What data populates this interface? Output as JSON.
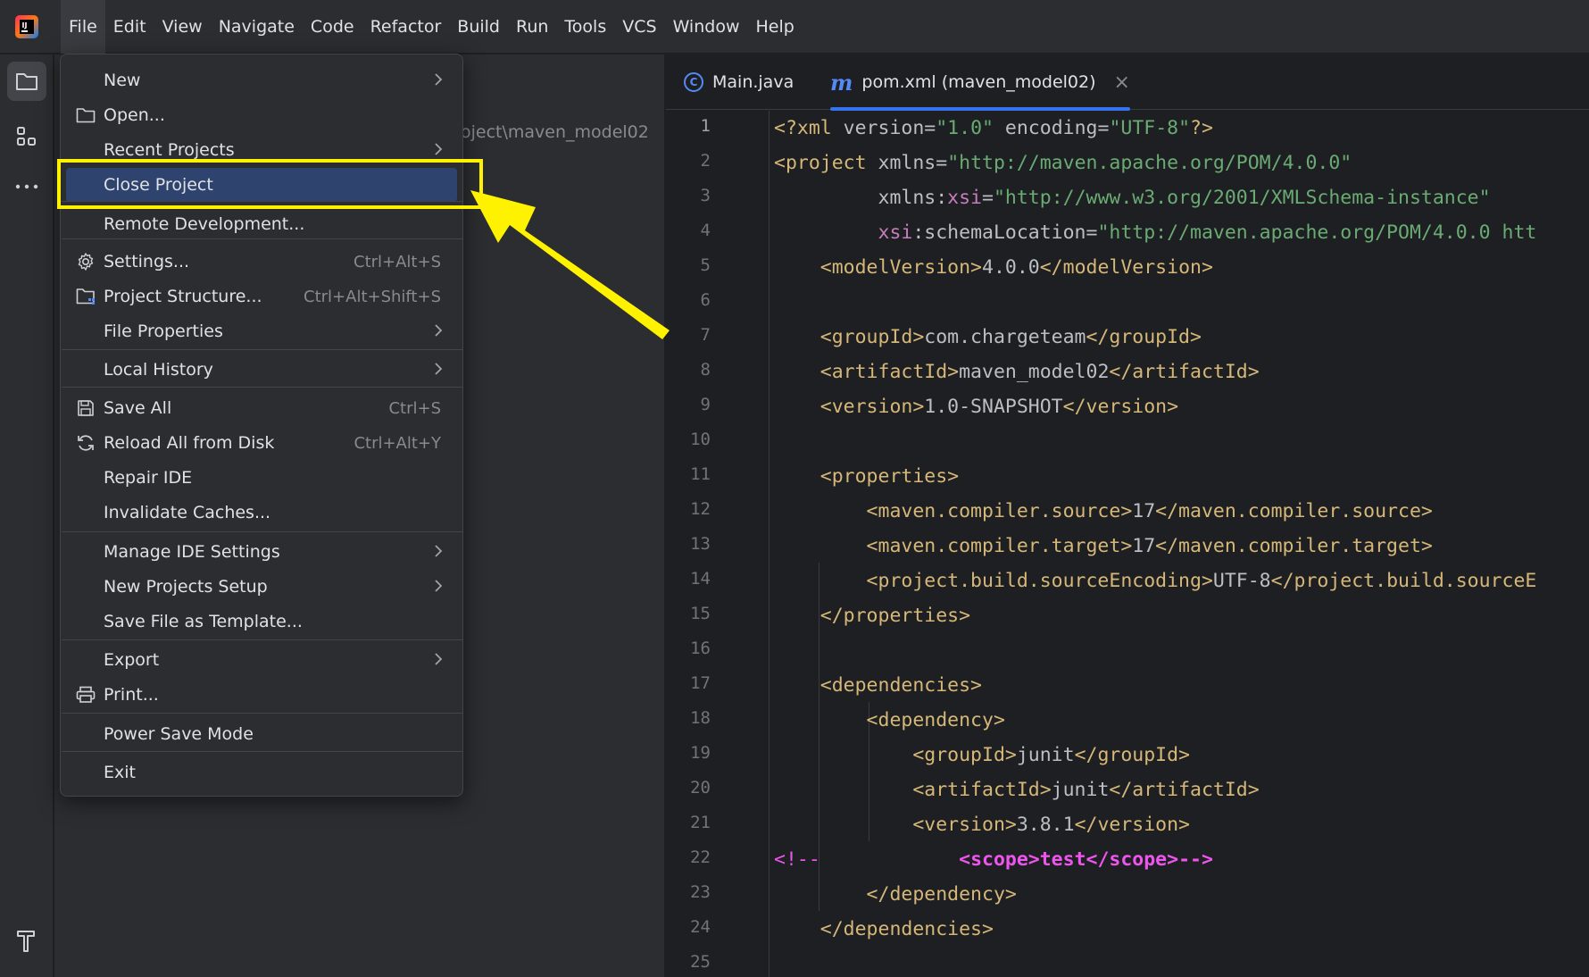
{
  "menubar": {
    "logo_icon": "intellij-idea-logo",
    "items": [
      {
        "label": "File",
        "active": true
      },
      {
        "label": "Edit"
      },
      {
        "label": "View"
      },
      {
        "label": "Navigate"
      },
      {
        "label": "Code"
      },
      {
        "label": "Refactor"
      },
      {
        "label": "Build"
      },
      {
        "label": "Run"
      },
      {
        "label": "Tools"
      },
      {
        "label": "VCS"
      },
      {
        "label": "Window"
      },
      {
        "label": "Help"
      }
    ]
  },
  "toolstrip": {
    "icons": [
      "folder-icon",
      "structure-icon",
      "more-icon",
      "build-hammer-icon"
    ]
  },
  "project_panel": {
    "path_fragment": "oject\\maven_model02"
  },
  "file_menu": {
    "items": [
      {
        "label": "New",
        "submenu": true
      },
      {
        "label": "Open...",
        "icon": "folder-icon"
      },
      {
        "label": "Recent Projects",
        "submenu": true
      },
      {
        "label": "Close Project",
        "highlighted": true
      },
      {
        "label": "Remote Development..."
      },
      {
        "label": "Settings...",
        "icon": "gear-icon",
        "shortcut": "Ctrl+Alt+S"
      },
      {
        "label": "Project Structure...",
        "icon": "project-structure-icon",
        "shortcut": "Ctrl+Alt+Shift+S"
      },
      {
        "label": "File Properties",
        "submenu": true
      },
      {
        "label": "Local History",
        "submenu": true
      },
      {
        "label": "Save All",
        "icon": "save-icon",
        "shortcut": "Ctrl+S"
      },
      {
        "label": "Reload All from Disk",
        "icon": "reload-icon",
        "shortcut": "Ctrl+Alt+Y"
      },
      {
        "label": "Repair IDE"
      },
      {
        "label": "Invalidate Caches..."
      },
      {
        "label": "Manage IDE Settings",
        "submenu": true
      },
      {
        "label": "New Projects Setup",
        "submenu": true
      },
      {
        "label": "Save File as Template..."
      },
      {
        "label": "Export",
        "submenu": true
      },
      {
        "label": "Print...",
        "icon": "print-icon"
      },
      {
        "label": "Power Save Mode"
      },
      {
        "label": "Exit"
      }
    ]
  },
  "editor": {
    "tabs": [
      {
        "label": "Main.java",
        "icon": "java-class-icon",
        "icon_glyph": "C"
      },
      {
        "label": "pom.xml (maven_model02)",
        "icon": "maven-icon",
        "icon_glyph": "m",
        "active": true,
        "close": "×"
      }
    ],
    "line_numbers": [
      "1",
      "2",
      "3",
      "4",
      "5",
      "6",
      "7",
      "8",
      "9",
      "10",
      "11",
      "12",
      "13",
      "14",
      "15",
      "16",
      "17",
      "18",
      "19",
      "20",
      "21",
      "22",
      "23",
      "24",
      "25"
    ],
    "code": {
      "l1": {
        "a": "<?xml ",
        "b": "version",
        "c": "=",
        "d": "\"1.0\"",
        "e": " ",
        "f": "encoding",
        "g": "=",
        "h": "\"UTF-8\"",
        "i": "?>"
      },
      "l2": {
        "a": "<project ",
        "b": "xmlns",
        "c": "=",
        "d": "\"http://maven.apache.org/POM/4.0.0\""
      },
      "l3": {
        "a": "         xmlns:",
        "b": "xsi",
        "c": "=",
        "d": "\"http://www.w3.org/2001/XMLSchema-instance\""
      },
      "l4": {
        "a": "         ",
        "b": "xsi",
        "c": ":schemaLocation=",
        "d": "\"http://maven.apache.org/POM/4.0.0 htt"
      },
      "l5": {
        "a": "    <modelVersion>",
        "b": "4.0.0",
        "c": "</modelVersion>"
      },
      "l7": {
        "a": "    <groupId>",
        "b": "com.chargeteam",
        "c": "</groupId>"
      },
      "l8": {
        "a": "    <artifactId>",
        "b": "maven_model02",
        "c": "</artifactId>"
      },
      "l9": {
        "a": "    <version>",
        "b": "1.0-SNAPSHOT",
        "c": "</version>"
      },
      "l11": {
        "a": "    <properties>"
      },
      "l12": {
        "a": "        <maven.compiler.source>",
        "b": "17",
        "c": "</maven.compiler.source>"
      },
      "l13": {
        "a": "        <maven.compiler.target>",
        "b": "17",
        "c": "</maven.compiler.target>"
      },
      "l14": {
        "a": "        <project.build.sourceEncoding>",
        "b": "UTF-8",
        "c": "</project.build.sourceE"
      },
      "l15": {
        "a": "    </properties>"
      },
      "l17": {
        "a": "    <dependencies>"
      },
      "l18": {
        "a": "        <dependency>"
      },
      "l19": {
        "a": "            <groupId>",
        "b": "junit",
        "c": "</groupId>"
      },
      "l20": {
        "a": "            <artifactId>",
        "b": "junit",
        "c": "</artifactId>"
      },
      "l21": {
        "a": "            <version>",
        "b": "3.8.1",
        "c": "</version>"
      },
      "l22": {
        "a": "<!--",
        "b": "            ",
        "c": "<scope>test</scope>-->"
      },
      "l23": {
        "a": "        </dependency>"
      },
      "l24": {
        "a": "    </dependencies>"
      }
    }
  },
  "annotation": {
    "color": "#fff200",
    "target": "Close Project"
  }
}
